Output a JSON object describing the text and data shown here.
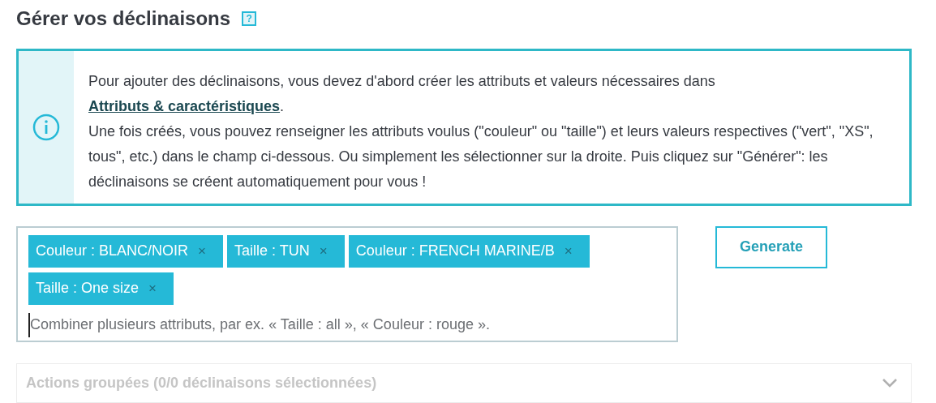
{
  "title": "Gérer vos déclinaisons",
  "help": {
    "label": "?"
  },
  "alert": {
    "text_before": "Pour ajouter des déclinaisons, vous devez d'abord créer les attributs et valeurs nécessaires dans ",
    "link": "Attributs & caractéristiques",
    "text_after": ".",
    "paragraph_2": "Une fois créés, vous pouvez renseigner les attributs voulus (\"couleur\" ou \"taille\") et leurs valeurs respectives (\"vert\", \"XS\", tous\", etc.) dans le champ ci-dessous. Ou simplement les sélectionner sur la droite. Puis cliquez sur \"Générer\": les déclinaisons se créent automatiquement pour vous !"
  },
  "tags": [
    {
      "label": "Couleur : BLANC/NOIR",
      "remove": "×"
    },
    {
      "label": "Taille : TUN",
      "remove": "×"
    },
    {
      "label": "Couleur : FRENCH MARINE/B",
      "remove": "×"
    },
    {
      "label": "Taille : One size",
      "remove": "×"
    }
  ],
  "tag_input": {
    "placeholder": "Combiner plusieurs attributs, par ex. « Taille : all », « Couleur : rouge »."
  },
  "generate_button": "Generate",
  "bulk_actions": {
    "label": "Actions groupées (0/0 déclinaisons sélectionnées)",
    "expanded": false
  }
}
